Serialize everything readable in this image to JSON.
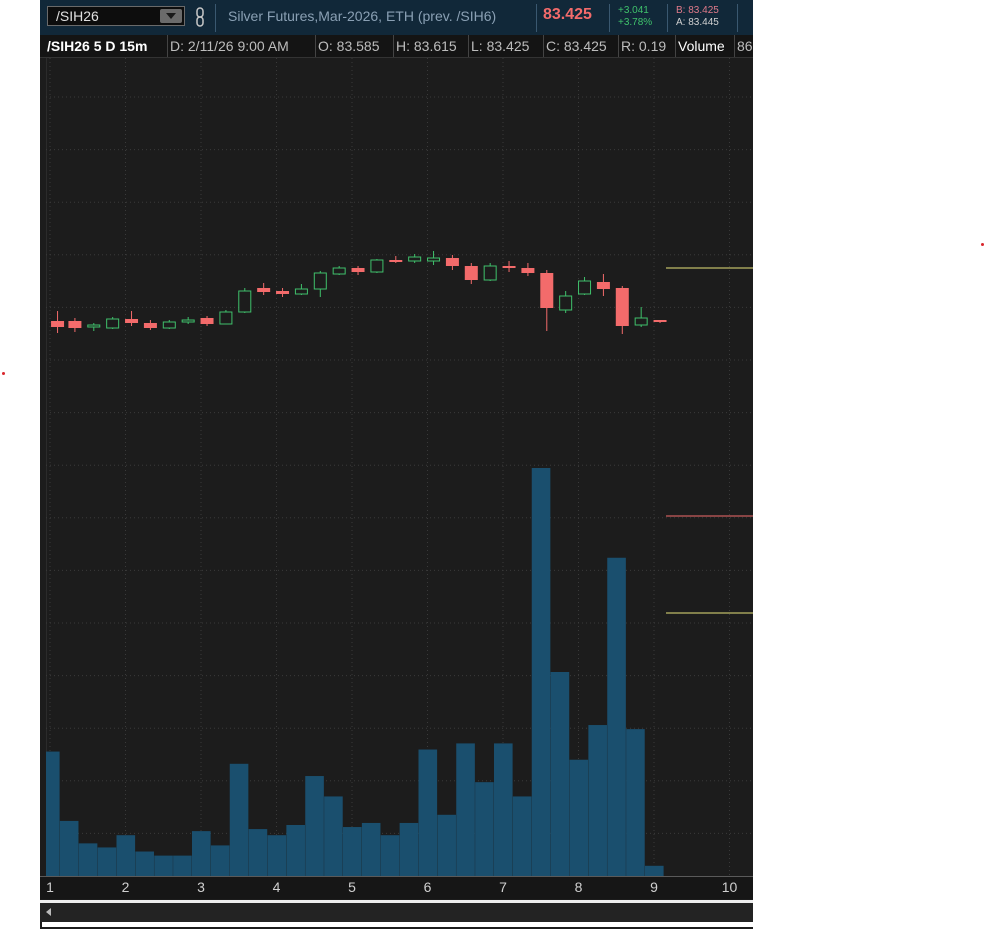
{
  "header": {
    "symbol": "/SIH26",
    "description": "Silver Futures,Mar-2026, ETH (prev. /SIH6)",
    "last_price": "83.425",
    "change": "+3.041",
    "change_pct": "+3.78%",
    "bid": "B: 83.425",
    "ask": "A: 83.445",
    "colors": {
      "header_bg": "#112839",
      "price_down": "#f36b6b",
      "change_up": "#3fc16b",
      "bid": "#e07a8a",
      "ask": "#d0d0d0"
    }
  },
  "info_bar": {
    "title": "/SIH26 5 D 15m",
    "date": "D: 2/11/26 9:00 AM",
    "open": "O: 83.585",
    "high": "H: 83.615",
    "low": "L: 83.425",
    "close": "C: 83.425",
    "range": "R: 0.19",
    "volume_label": "Volume",
    "volume_value": "86"
  },
  "x_ticks": [
    "1",
    "2",
    "3",
    "4",
    "5",
    "6",
    "7",
    "8",
    "9",
    "10"
  ],
  "chart_data": {
    "type": "candlestick+bar",
    "x_range": [
      1,
      10.1
    ],
    "price_axis_range": [
      0,
      818
    ],
    "volume_axis_range": [
      0,
      100
    ],
    "grid": true,
    "colors": {
      "up": "#3fc16b",
      "down": "#f36b6b",
      "volume": "#1a4f6e",
      "background": "#1c1c1c",
      "grid": "#3a3a3a"
    },
    "candles": [
      {
        "x": 1.1,
        "o": 263,
        "h": 253,
        "l": 275,
        "c": 269
      },
      {
        "x": 1.33,
        "o": 263,
        "h": 260,
        "l": 274,
        "c": 270
      },
      {
        "x": 1.58,
        "o": 269,
        "h": 265,
        "l": 273,
        "c": 267
      },
      {
        "x": 1.83,
        "o": 270,
        "h": 259,
        "l": 271,
        "c": 261
      },
      {
        "x": 2.08,
        "o": 261,
        "h": 253,
        "l": 268,
        "c": 265
      },
      {
        "x": 2.33,
        "o": 265,
        "h": 262,
        "l": 272,
        "c": 270
      },
      {
        "x": 2.58,
        "o": 270,
        "h": 262,
        "l": 271,
        "c": 264
      },
      {
        "x": 2.83,
        "o": 264,
        "h": 259,
        "l": 266,
        "c": 262
      },
      {
        "x": 3.08,
        "o": 260,
        "h": 258,
        "l": 268,
        "c": 266
      },
      {
        "x": 3.33,
        "o": 266,
        "h": 252,
        "l": 266,
        "c": 254
      },
      {
        "x": 3.58,
        "o": 254,
        "h": 230,
        "l": 255,
        "c": 233
      },
      {
        "x": 3.83,
        "o": 230,
        "h": 225,
        "l": 237,
        "c": 234
      },
      {
        "x": 4.08,
        "o": 233,
        "h": 230,
        "l": 239,
        "c": 236
      },
      {
        "x": 4.33,
        "o": 236,
        "h": 226,
        "l": 237,
        "c": 231
      },
      {
        "x": 4.58,
        "o": 231,
        "h": 213,
        "l": 239,
        "c": 215
      },
      {
        "x": 4.83,
        "o": 216,
        "h": 208,
        "l": 217,
        "c": 210
      },
      {
        "x": 5.08,
        "o": 210,
        "h": 208,
        "l": 217,
        "c": 214
      },
      {
        "x": 5.33,
        "o": 214,
        "h": 201,
        "l": 215,
        "c": 202
      },
      {
        "x": 5.58,
        "o": 202,
        "h": 198,
        "l": 205,
        "c": 204
      },
      {
        "x": 5.83,
        "o": 203,
        "h": 196,
        "l": 205,
        "c": 199
      },
      {
        "x": 6.08,
        "o": 203,
        "h": 193,
        "l": 207,
        "c": 200
      },
      {
        "x": 6.33,
        "o": 200,
        "h": 197,
        "l": 212,
        "c": 208
      },
      {
        "x": 6.58,
        "o": 208,
        "h": 205,
        "l": 226,
        "c": 222
      },
      {
        "x": 6.83,
        "o": 222,
        "h": 205,
        "l": 223,
        "c": 208
      },
      {
        "x": 7.08,
        "o": 208,
        "h": 203,
        "l": 214,
        "c": 210
      },
      {
        "x": 7.33,
        "o": 210,
        "h": 205,
        "l": 218,
        "c": 215
      },
      {
        "x": 7.58,
        "o": 215,
        "h": 212,
        "l": 273,
        "c": 250
      },
      {
        "x": 7.83,
        "o": 252,
        "h": 233,
        "l": 255,
        "c": 238
      },
      {
        "x": 8.08,
        "o": 236,
        "h": 219,
        "l": 237,
        "c": 223
      },
      {
        "x": 8.33,
        "o": 224,
        "h": 216,
        "l": 238,
        "c": 231
      },
      {
        "x": 8.58,
        "o": 230,
        "h": 228,
        "l": 276,
        "c": 268
      },
      {
        "x": 8.83,
        "o": 267,
        "h": 249,
        "l": 269,
        "c": 260
      },
      {
        "x": 9.08,
        "o": 262,
        "h": 262,
        "l": 265,
        "c": 264
      }
    ],
    "volume": [
      {
        "x": 1.0,
        "v": 30.5
      },
      {
        "x": 1.25,
        "v": 13.5
      },
      {
        "x": 1.5,
        "v": 8.0
      },
      {
        "x": 1.75,
        "v": 7.0
      },
      {
        "x": 2.0,
        "v": 10.0
      },
      {
        "x": 2.25,
        "v": 6.0
      },
      {
        "x": 2.5,
        "v": 5.0
      },
      {
        "x": 2.75,
        "v": 5.0
      },
      {
        "x": 3.0,
        "v": 11.0
      },
      {
        "x": 3.25,
        "v": 7.5
      },
      {
        "x": 3.5,
        "v": 27.5
      },
      {
        "x": 3.75,
        "v": 11.5
      },
      {
        "x": 4.0,
        "v": 10.0
      },
      {
        "x": 4.25,
        "v": 12.5
      },
      {
        "x": 4.5,
        "v": 24.5
      },
      {
        "x": 4.75,
        "v": 19.5
      },
      {
        "x": 5.0,
        "v": 12.0
      },
      {
        "x": 5.25,
        "v": 13.0
      },
      {
        "x": 5.5,
        "v": 10.0
      },
      {
        "x": 5.75,
        "v": 13.0
      },
      {
        "x": 6.0,
        "v": 31.0
      },
      {
        "x": 6.25,
        "v": 15.0
      },
      {
        "x": 6.5,
        "v": 32.5
      },
      {
        "x": 6.75,
        "v": 23.0
      },
      {
        "x": 7.0,
        "v": 32.5
      },
      {
        "x": 7.25,
        "v": 19.5
      },
      {
        "x": 7.5,
        "v": 100.0
      },
      {
        "x": 7.75,
        "v": 50.0
      },
      {
        "x": 8.0,
        "v": 28.5
      },
      {
        "x": 8.25,
        "v": 37.0
      },
      {
        "x": 8.5,
        "v": 78.0
      },
      {
        "x": 8.75,
        "v": 36.0
      },
      {
        "x": 9.0,
        "v": 2.5
      }
    ],
    "level_lines": [
      {
        "name": "upper-level-line",
        "color": "#e6e27a"
      },
      {
        "name": "middle-level-line",
        "color": "#f36b6b"
      },
      {
        "name": "lower-level-line",
        "color": "#e6e27a"
      }
    ]
  }
}
